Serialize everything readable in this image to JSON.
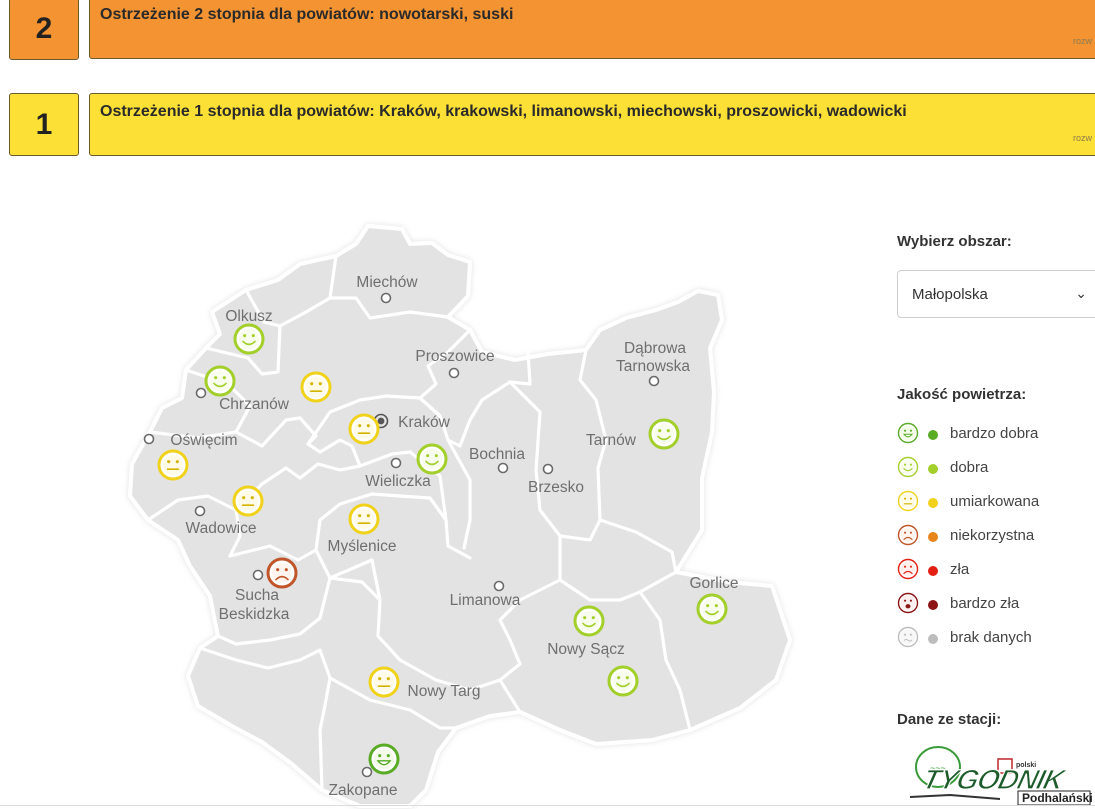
{
  "alerts": [
    {
      "level": "2",
      "text": "Ostrzeżenie 2 stopnia dla powiatów: nowotarski, suski",
      "more": "rozw",
      "color": "#f39331"
    },
    {
      "level": "1",
      "text": "Ostrzeżenie 1 stopnia dla powiatów: Kraków, krakowski, limanowski, miechowski, proszowicki, wadowicki",
      "more": "rozw",
      "color": "#fde035"
    }
  ],
  "map": {
    "cities": {
      "miechow": "Miechów",
      "olkusz": "Olkusz",
      "proszowice": "Proszowice",
      "dabrowa1": "Dąbrowa",
      "dabrowa2": "Tarnowska",
      "chrzanow": "Chrzanów",
      "krakow": "Kraków",
      "oswiecim": "Oświęcim",
      "tarnow": "Tarnów",
      "bochnia": "Bochnia",
      "wieliczka": "Wieliczka",
      "brzesko": "Brzesko",
      "wadowice": "Wadowice",
      "myslenice": "Myślenice",
      "sucha1": "Sucha",
      "sucha2": "Beskidzka",
      "limanowa": "Limanowa",
      "gorlice": "Gorlice",
      "nowysacz": "Nowy Sącz",
      "nowytarg": "Nowy Targ",
      "zakopane": "Zakopane"
    },
    "stations": [
      {
        "id": "olkusz",
        "quality": "dobra"
      },
      {
        "id": "chrzanow",
        "quality": "dobra"
      },
      {
        "id": "krakowski-north",
        "quality": "umiarkowana"
      },
      {
        "id": "krakow",
        "quality": "umiarkowana"
      },
      {
        "id": "wieliczka",
        "quality": "dobra"
      },
      {
        "id": "oswiecim",
        "quality": "umiarkowana"
      },
      {
        "id": "wadowice",
        "quality": "umiarkowana"
      },
      {
        "id": "myslenice",
        "quality": "umiarkowana"
      },
      {
        "id": "sucha",
        "quality": "niekorzystna"
      },
      {
        "id": "tarnow",
        "quality": "dobra"
      },
      {
        "id": "nowysacz-1",
        "quality": "dobra"
      },
      {
        "id": "nowysacz-2",
        "quality": "dobra"
      },
      {
        "id": "gorlice",
        "quality": "dobra"
      },
      {
        "id": "nowytarg",
        "quality": "umiarkowana"
      },
      {
        "id": "zakopane",
        "quality": "bardzo dobra"
      }
    ]
  },
  "panel": {
    "area_label": "Wybierz obszar:",
    "area_value": "Małopolska",
    "quality_label": "Jakość powietrza:",
    "legend": [
      {
        "label": "bardzo dobra",
        "color": "#5aab26"
      },
      {
        "label": "dobra",
        "color": "#a3cf2a"
      },
      {
        "label": "umiarkowana",
        "color": "#f1d21b"
      },
      {
        "label": "niekorzystna",
        "color": "#e8851a"
      },
      {
        "label": "zła",
        "color": "#e21f12"
      },
      {
        "label": "bardzo zła",
        "color": "#8c1414"
      },
      {
        "label": "brak danych",
        "color": "#bdbdbd"
      }
    ],
    "stations_label": "Dane ze stacji:"
  },
  "colors": {
    "map_fill": "#e3e3e3",
    "map_border": "#ffffff",
    "marker_face_good": "#a3cf2a",
    "marker_face_moderate": "#f1d21b",
    "marker_face_bad": "#c0552a"
  }
}
